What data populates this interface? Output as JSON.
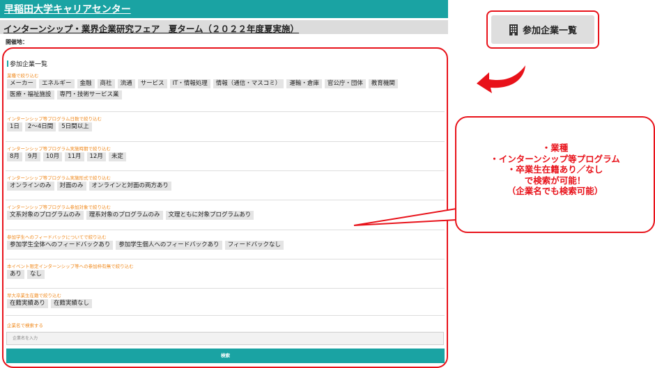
{
  "header": {
    "title": "早稲田大学キャリアセンター"
  },
  "event": {
    "title": "インターンシップ・業界企業研究フェア　夏ターム（２０２２年度夏実施）"
  },
  "venue": {
    "label": "開催地："
  },
  "panel": {
    "heading": "参加企業一覧"
  },
  "sections": [
    {
      "label": "業種で絞り込む",
      "rows": [
        [
          "メーカー",
          "エネルギー",
          "金融",
          "商社",
          "流通",
          "サービス",
          "IT・情報処理",
          "情報（通信・マスコミ）",
          "運輸・倉庫",
          "官公庁・団体",
          "教育機関"
        ],
        [
          "医療・福祉施設",
          "専門・技術サービス業"
        ]
      ]
    },
    {
      "label": "インターンシップ等プログラム日数で絞り込む",
      "rows": [
        [
          "1日",
          "2〜4日間",
          "5日間以上"
        ]
      ]
    },
    {
      "label": "インターンシップ等プログラム実施時期で絞り込む",
      "rows": [
        [
          "8月",
          "9月",
          "10月",
          "11月",
          "12月",
          "未定"
        ]
      ]
    },
    {
      "label": "インターンシップ等プログラム実施形式で絞り込む",
      "rows": [
        [
          "オンラインのみ",
          "対面のみ",
          "オンラインと対面の両方あり"
        ]
      ]
    },
    {
      "label": "インターンシップ等プログラム参加対象で絞り込む",
      "rows": [
        [
          "文系対象のプログラムのみ",
          "理系対象のプログラムのみ",
          "文理ともに対象プログラムあり"
        ]
      ]
    },
    {
      "label": "参加学生へのフィードバックについてで絞り込む",
      "rows": [
        [
          "参加学生全体へのフィードバックあり",
          "参加学生個人へのフィードバックあり",
          "フィードバックなし"
        ]
      ]
    },
    {
      "label": "本イベント限定インターンシップ等への参加枠有無で絞り込む",
      "rows": [
        [
          "あり",
          "なし"
        ]
      ]
    },
    {
      "label": "早大卒業生在籍で絞り込む",
      "rows": [
        [
          "在籍実績あり",
          "在籍実績なし"
        ]
      ]
    }
  ],
  "search": {
    "label": "企業名で検索する",
    "placeholder": "企業名を入力",
    "button": "検索"
  },
  "company_list_button": {
    "label": "参加企業一覧",
    "icon": "building-icon"
  },
  "callout": {
    "lines": [
      "・業種",
      "・インターンシップ等プログラム",
      "・卒業生在籍あり／なし",
      "で検索が可能！",
      "（企業名でも検索可能）"
    ]
  },
  "colors": {
    "accent": "#1aa3a3",
    "highlight": "#e8121a",
    "section_label": "#f0891c",
    "tag_bg": "#e4e4e4"
  }
}
